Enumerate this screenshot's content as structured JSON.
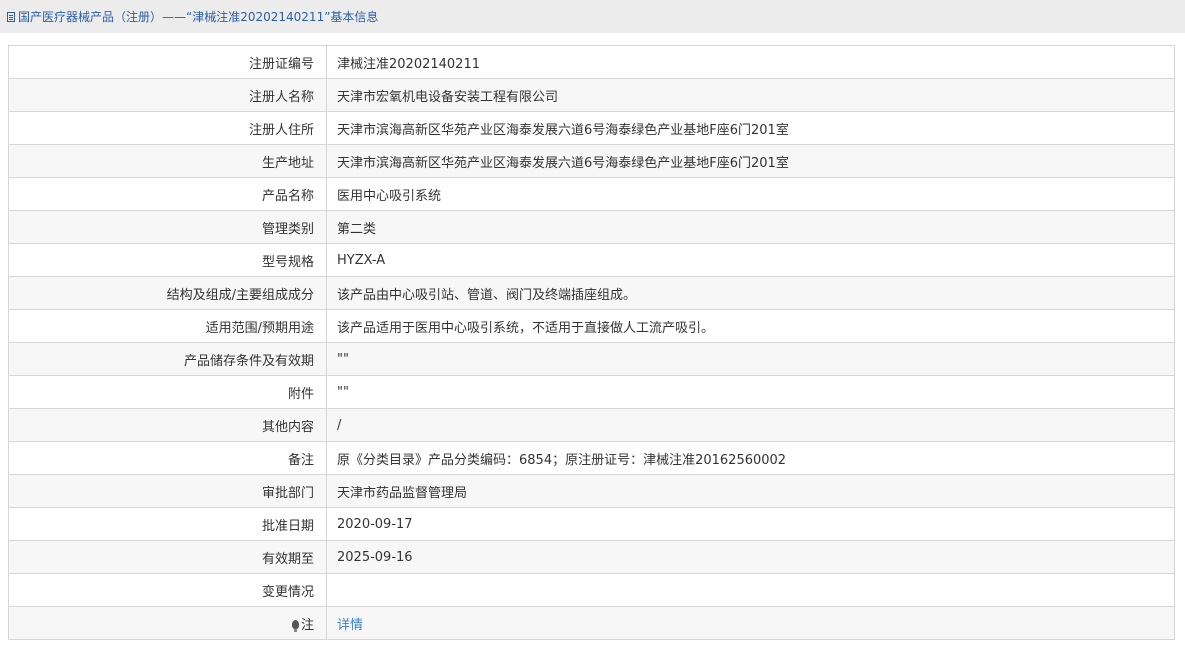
{
  "header": {
    "breadcrumb": "国产医疗器械产品（注册）——“津械注准20202140211”基本信息"
  },
  "rows": [
    {
      "label": "注册证编号",
      "value": "津械注准20202140211"
    },
    {
      "label": "注册人名称",
      "value": "天津市宏氧机电设备安装工程有限公司"
    },
    {
      "label": "注册人住所",
      "value": "天津市滨海高新区华苑产业区海泰发展六道6号海泰绿色产业基地F座6门201室"
    },
    {
      "label": "生产地址",
      "value": "天津市滨海高新区华苑产业区海泰发展六道6号海泰绿色产业基地F座6门201室"
    },
    {
      "label": "产品名称",
      "value": "医用中心吸引系统"
    },
    {
      "label": "管理类别",
      "value": "第二类"
    },
    {
      "label": "型号规格",
      "value": "HYZX-A"
    },
    {
      "label": "结构及组成/主要组成成分",
      "value": "该产品由中心吸引站、管道、阀门及终端插座组成。"
    },
    {
      "label": "适用范围/预期用途",
      "value": "该产品适用于医用中心吸引系统，不适用于直接做人工流产吸引。"
    },
    {
      "label": "产品储存条件及有效期",
      "value": "\"\""
    },
    {
      "label": "附件",
      "value": "\"\""
    },
    {
      "label": "其他内容",
      "value": "/"
    },
    {
      "label": "备注",
      "value": "原《分类目录》产品分类编码：6854；原注册证号：津械注准20162560002"
    },
    {
      "label": "审批部门",
      "value": "天津市药品监督管理局"
    },
    {
      "label": "批准日期",
      "value": "2020-09-17"
    },
    {
      "label": "有效期至",
      "value": "2025-09-16"
    },
    {
      "label": "变更情况",
      "value": ""
    }
  ],
  "note": {
    "icon": "lightbulb-icon",
    "label": "注",
    "link_text": "详情",
    "link_color": "#3a7fcf"
  }
}
